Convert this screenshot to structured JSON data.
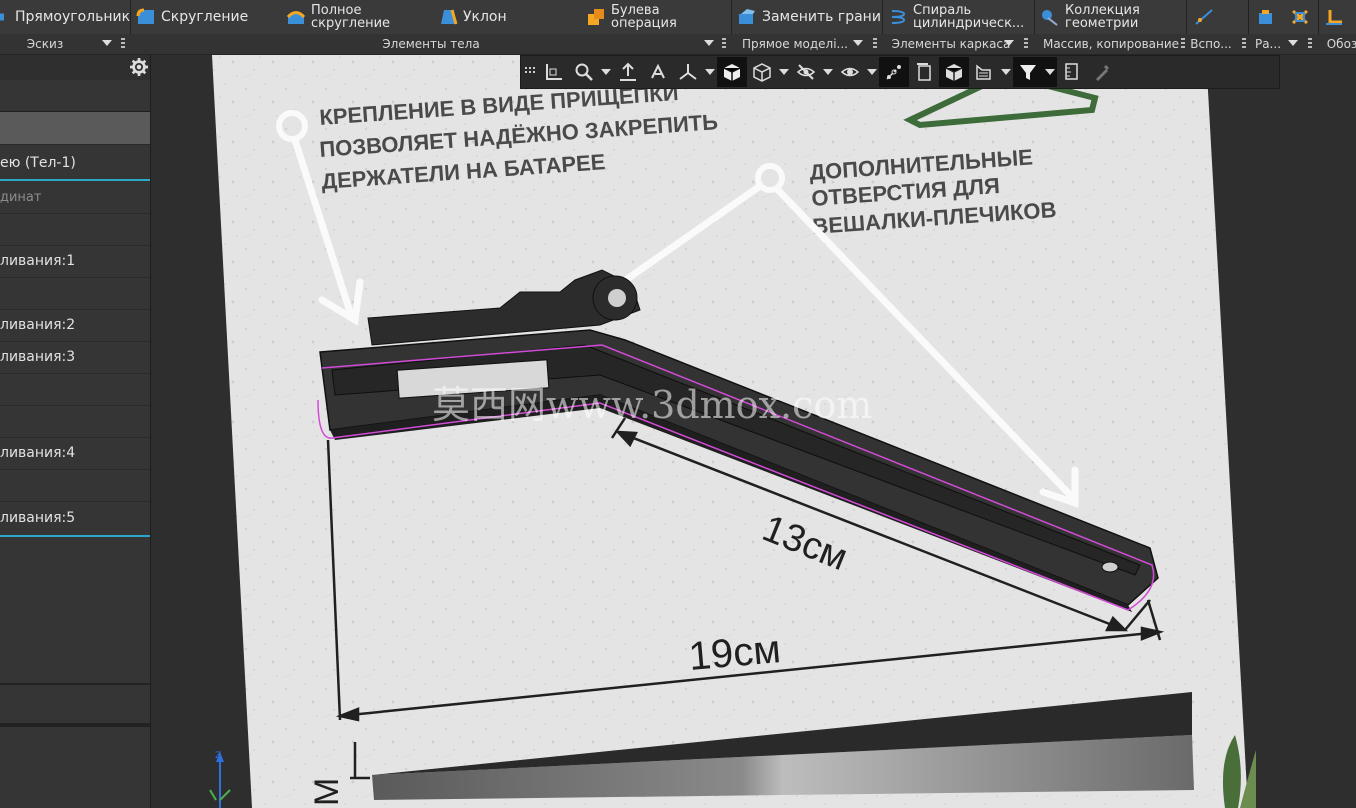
{
  "ribbon": {
    "buttons": [
      {
        "label": "Прямоугольник",
        "icon": "rectangle-icon"
      },
      {
        "label": "Скругление",
        "icon": "fillet-icon"
      },
      {
        "label": "Полное скругление",
        "icon": "full-fillet-icon"
      },
      {
        "label": "Уклон",
        "icon": "draft-icon"
      },
      {
        "label": "Булева операция",
        "icon": "boolean-icon"
      },
      {
        "label": "Заменить грани",
        "icon": "replace-faces-icon"
      },
      {
        "label": "Спираль цилиндрическ...",
        "icon": "spiral-icon"
      },
      {
        "label": "Коллекция геометрии",
        "icon": "geometry-collection-icon"
      }
    ],
    "groups": [
      {
        "label": "Эскиз"
      },
      {
        "label": "Элементы тела"
      },
      {
        "label": "Прямое моделі..."
      },
      {
        "label": "Элементы каркаса"
      },
      {
        "label": "Массив, копирование"
      },
      {
        "label": "Вспо..."
      },
      {
        "label": "Ра..."
      },
      {
        "label": "Обоз"
      }
    ]
  },
  "tree": {
    "items": [
      {
        "label": "",
        "selected": true
      },
      {
        "label": "ею (Тел-1)",
        "accent": true
      },
      {
        "label": "динат",
        "dim": true
      },
      {
        "label": ""
      },
      {
        "label": "ливания:1"
      },
      {
        "label": ""
      },
      {
        "label": "ливания:2"
      },
      {
        "label": "ливания:3"
      },
      {
        "label": ""
      },
      {
        "label": ""
      },
      {
        "label": "ливания:4"
      },
      {
        "label": ""
      },
      {
        "label": "ливания:5",
        "accent": true
      }
    ]
  },
  "scene": {
    "label_clip_1": "КРЕПЛЕНИЕ В ВИДЕ ПРИЩЕПКИ",
    "label_clip_2": "ПОЗВОЛЯЕТ НАДЁЖНО ЗАКРЕПИТЬ",
    "label_clip_3": "ДЕРЖАТЕЛИ НА БАТАРЕЕ",
    "label_holes_1": "ДОПОЛНИТЕЛЬНЫЕ",
    "label_holes_2": "ОТВЕРСТИЯ ДЛЯ",
    "label_holes_3": "ВЕШАЛКИ-ПЛЕЧИКОВ",
    "dim_13": "13см",
    "dim_19": "19см",
    "dim_side": "М",
    "watermark": "莫西网www.3dmox.com"
  },
  "colors": {
    "accent": "#2aa9c9",
    "highlight_edge": "#d24bd6",
    "part": "#2a2a2a"
  }
}
